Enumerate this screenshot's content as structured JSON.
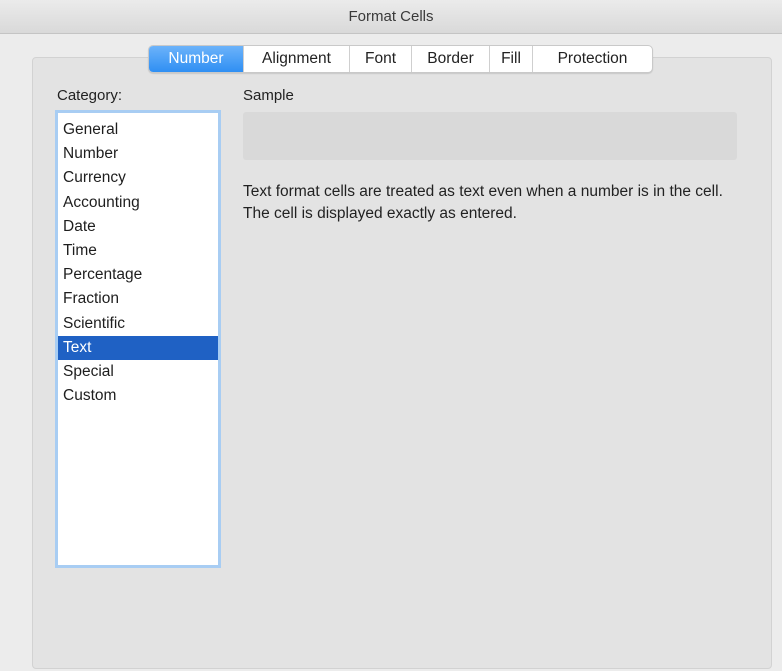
{
  "window": {
    "title": "Format Cells"
  },
  "tabs": [
    {
      "label": "Number",
      "active": true
    },
    {
      "label": "Alignment",
      "active": false
    },
    {
      "label": "Font",
      "active": false
    },
    {
      "label": "Border",
      "active": false
    },
    {
      "label": "Fill",
      "active": false
    },
    {
      "label": "Protection",
      "active": false
    }
  ],
  "category": {
    "label": "Category:",
    "items": [
      "General",
      "Number",
      "Currency",
      "Accounting",
      "Date",
      "Time",
      "Percentage",
      "Fraction",
      "Scientific",
      "Text",
      "Special",
      "Custom"
    ],
    "selected": "Text"
  },
  "sample": {
    "label": "Sample",
    "value": ""
  },
  "description": "Text format cells are treated as text even when a number is in the cell.  The cell is displayed exactly as entered.",
  "colors": {
    "accent": "#2f8ff3",
    "selection": "#1f61c4",
    "list_focus_ring": "#a8cdf3"
  }
}
